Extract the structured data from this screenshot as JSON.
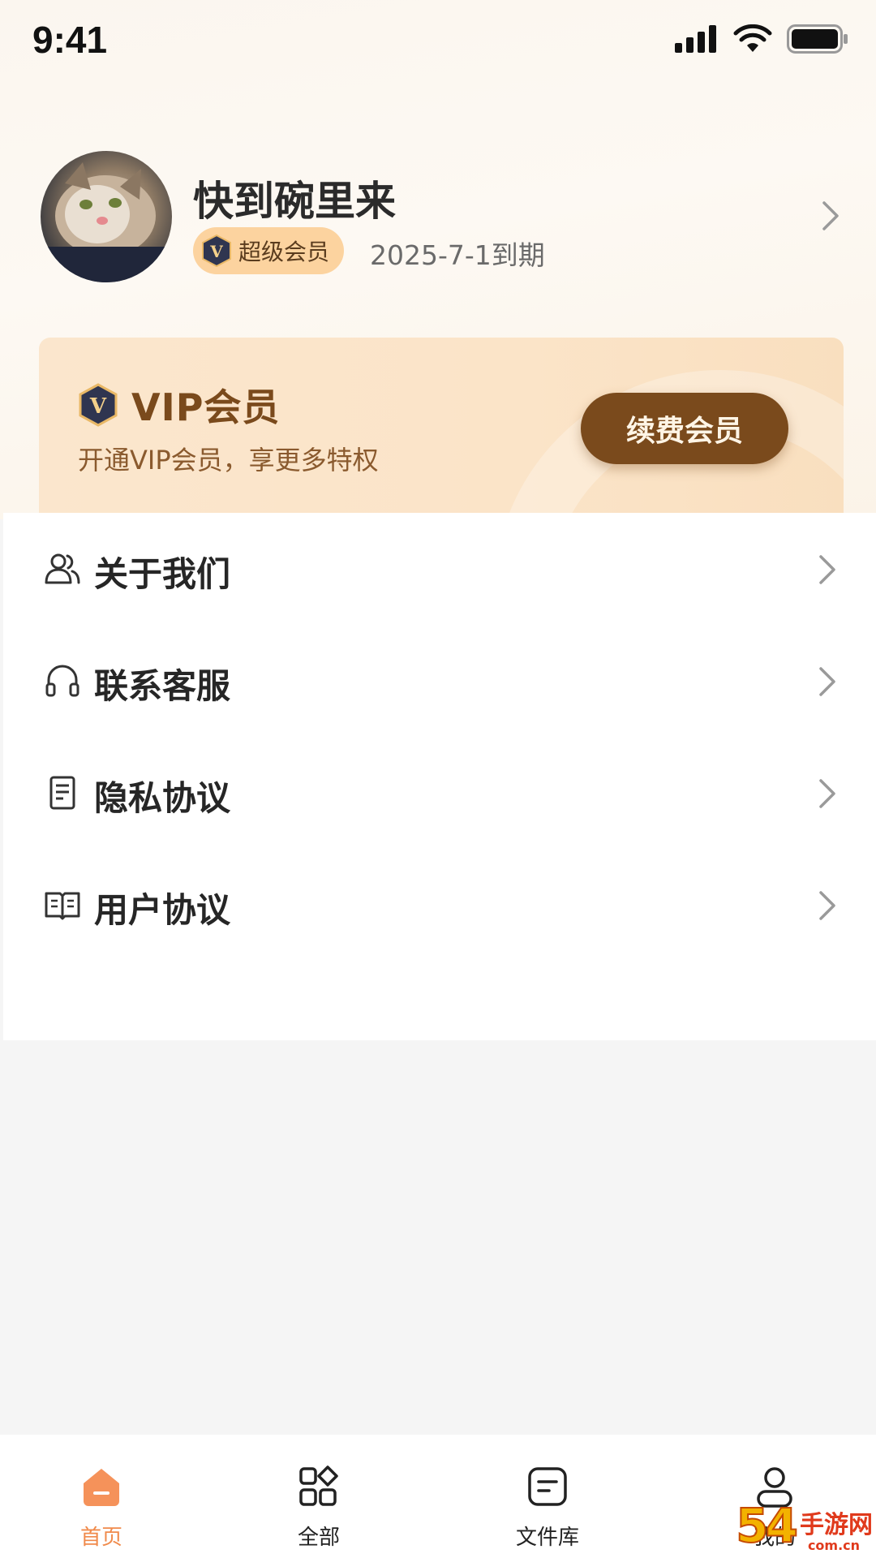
{
  "status_bar": {
    "time": "9:41",
    "icons": [
      "signal-icon",
      "wifi-icon",
      "battery-icon"
    ]
  },
  "profile": {
    "name": "快到碗里来",
    "badge_label": "超级会员",
    "badge_icon": "v-shield-icon",
    "expire": "2025-7-1到期"
  },
  "vip_card": {
    "title": "VIP会员",
    "subtitle": "开通VIP会员，享更多特权",
    "button": "续费会员"
  },
  "menu": {
    "items": [
      {
        "label": "关于我们",
        "icon": "users-icon"
      },
      {
        "label": "联系客服",
        "icon": "headset-icon"
      },
      {
        "label": "隐私协议",
        "icon": "document-icon"
      },
      {
        "label": "用户协议",
        "icon": "book-icon"
      }
    ]
  },
  "tab_bar": {
    "tabs": [
      {
        "label": "首页",
        "icon": "home-icon",
        "active": true
      },
      {
        "label": "全部",
        "icon": "grid-icon",
        "active": false
      },
      {
        "label": "文件库",
        "icon": "file-library-icon",
        "active": false
      },
      {
        "label": "我的",
        "icon": "profile-icon",
        "active": false
      }
    ]
  },
  "colors": {
    "accent": "#f08a4b",
    "vip_brown": "#7a4a1c",
    "badge_bg": "#fcd39f"
  },
  "watermark": {
    "num": "54",
    "site": "手游网",
    "domain": "com.cn"
  }
}
